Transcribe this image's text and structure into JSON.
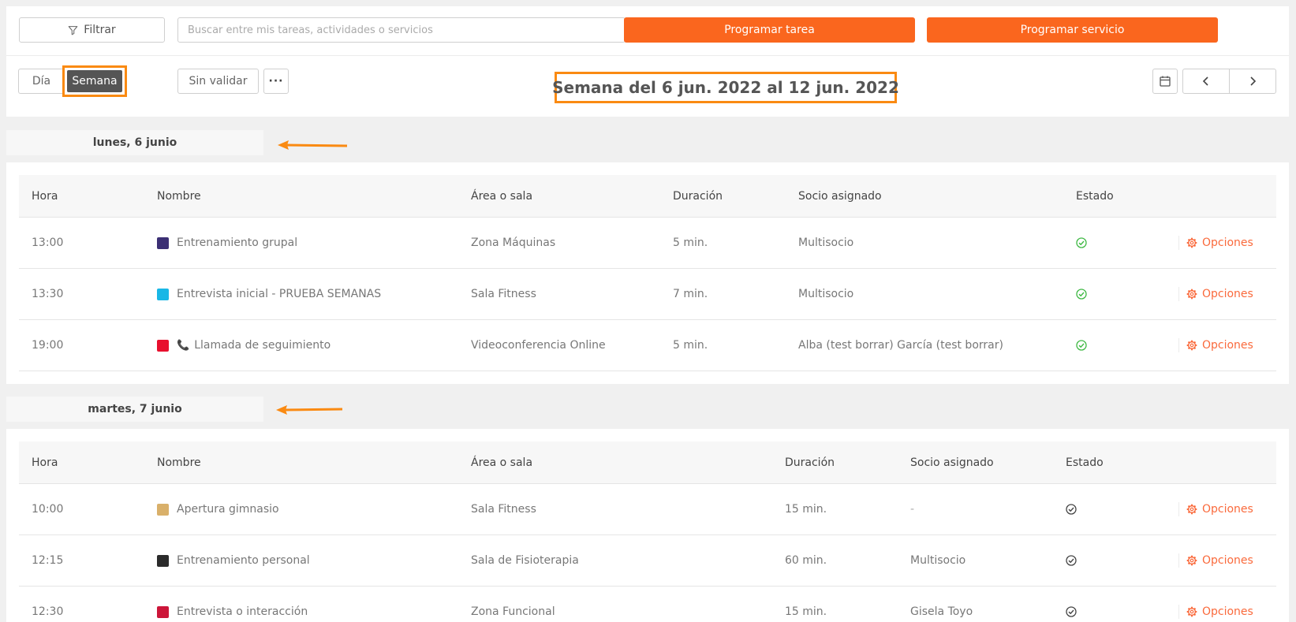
{
  "toolbar": {
    "filter_label": "Filtrar",
    "search_placeholder": "Buscar entre mis tareas, actividades o servicios",
    "program_task_label": "Programar tarea",
    "program_service_label": "Programar servicio"
  },
  "view": {
    "dia_label": "Día",
    "semana_label": "Semana",
    "sin_validar_label": "Sin validar",
    "more_label": "···",
    "week_title": "Semana del 6 jun. 2022 al 12 jun. 2022"
  },
  "icons": {
    "filter": "filter-icon",
    "calendar": "calendar-icon",
    "prev": "chevron-left-icon",
    "next": "chevron-right-icon",
    "status": "check-circle-icon",
    "options": "gear-icon",
    "phone": "phone-icon"
  },
  "colors": {
    "accent": "#fa661e",
    "highlight": "#fa8a12",
    "status_green": "#3fb944",
    "status_dark": "#444444",
    "options": "#fa6a3c"
  },
  "days": [
    {
      "label": "lunes, 6 junio",
      "headers": {
        "hora": "Hora",
        "nombre": "Nombre",
        "area": "Área o sala",
        "duracion": "Duración",
        "socio": "Socio asignado",
        "estado": "Estado"
      },
      "rows": [
        {
          "hora": "13:00",
          "color": "#3b2f74",
          "phone": "",
          "nombre": "Entrenamiento grupal",
          "area": "Zona Máquinas",
          "duracion": "5 min.",
          "socio": "Multisocio",
          "estado": "validated",
          "opciones": "Opciones"
        },
        {
          "hora": "13:30",
          "color": "#19b7e6",
          "phone": "",
          "nombre": "Entrevista inicial - PRUEBA SEMANAS",
          "area": "Sala Fitness",
          "duracion": "7 min.",
          "socio": "Multisocio",
          "estado": "validated",
          "opciones": "Opciones"
        },
        {
          "hora": "19:00",
          "color": "#e8102e",
          "phone": "📞",
          "nombre": "Llamada de seguimiento",
          "area": "Videoconferencia Online",
          "duracion": "5 min.",
          "socio": "Alba (test borrar) García (test borrar)",
          "estado": "validated",
          "opciones": "Opciones"
        }
      ]
    },
    {
      "label": "martes, 7 junio",
      "headers": {
        "hora": "Hora",
        "nombre": "Nombre",
        "area": "Área o sala",
        "duracion": "Duración",
        "socio": "Socio asignado",
        "estado": "Estado"
      },
      "rows": [
        {
          "hora": "10:00",
          "color": "#d9b06a",
          "phone": "",
          "nombre": "Apertura gimnasio",
          "area": "Sala Fitness",
          "duracion": "15 min.",
          "socio": "-",
          "estado": "pending",
          "opciones": "Opciones"
        },
        {
          "hora": "12:15",
          "color": "#2b2b2b",
          "phone": "",
          "nombre": "Entrenamiento personal",
          "area": "Sala de Fisioterapia",
          "duracion": "60 min.",
          "socio": "Multisocio",
          "estado": "pending",
          "opciones": "Opciones"
        },
        {
          "hora": "12:30",
          "color": "#cc1639",
          "phone": "",
          "nombre": "Entrevista o interacción",
          "area": "Zona Funcional",
          "duracion": "15 min.",
          "socio": "Gisela Toyo",
          "estado": "pending",
          "opciones": "Opciones"
        }
      ]
    }
  ]
}
